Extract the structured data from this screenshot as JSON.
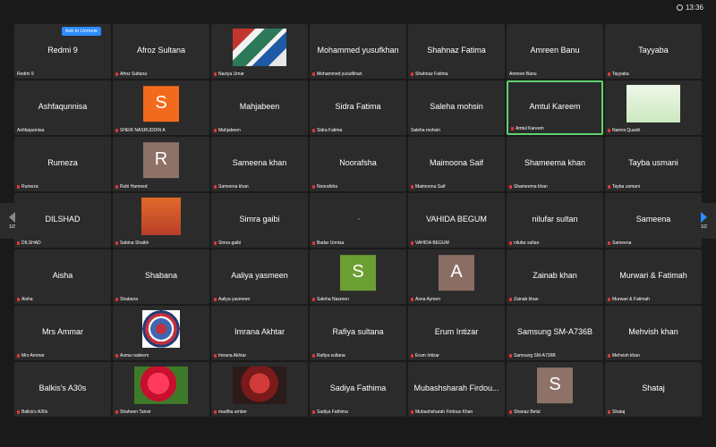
{
  "clock": "13:36",
  "unmute_label": "Ask to Unmute",
  "more_label": "···",
  "pager_left": "1/2",
  "pager_right": "1/2",
  "colors": {
    "orange": "#f26a1b",
    "taupe": "#8e7268",
    "green": "#6c9f32",
    "brown": "#8a6e64",
    "active": "#5fd36f",
    "accent": "#2d8cff"
  },
  "tiles": [
    {
      "name": "Redmi 9",
      "label": "Redmi 9"
    },
    {
      "name": "Afroz Sultana",
      "label": "Afroz Sultana"
    },
    {
      "name": "",
      "label": "Naziya Umar",
      "media": "mosaic"
    },
    {
      "name": "Mohammed yusufkhan",
      "label": "Mohammed yusufkhan"
    },
    {
      "name": "Shahnaz Fatima",
      "label": "Shahnaz Fatima"
    },
    {
      "name": "Amreen Banu",
      "label": "Amreen Banu"
    },
    {
      "name": "Tayyaba",
      "label": "Tayyaba"
    },
    {
      "name": "Ashfaqunnisa",
      "label": "Ashfaqunnisa"
    },
    {
      "name": "",
      "label": "SHEIK NASRUDDIN A",
      "avatar": "S",
      "color": "orange"
    },
    {
      "name": "Mahjabeen",
      "label": "Mahjabeen"
    },
    {
      "name": "Sidra Fatima",
      "label": "Sidra Fatima"
    },
    {
      "name": "Saleha mohsin",
      "label": "Saleha mohsin"
    },
    {
      "name": "Amtul Kareem",
      "label": "Amtul Kareem",
      "active": true
    },
    {
      "name": "",
      "label": "Namra Quadri",
      "media": "quote"
    },
    {
      "name": "Rumeza",
      "label": "Rumeza"
    },
    {
      "name": "",
      "label": "Ruhi Hameed",
      "avatar": "R",
      "color": "taupe"
    },
    {
      "name": "Sameena khan",
      "label": "Sameena khan"
    },
    {
      "name": "Noorafsha",
      "label": "Noorafsha"
    },
    {
      "name": "Maimoona Saif",
      "label": "Maimoona Saif"
    },
    {
      "name": "Shameema khan",
      "label": "Shameema khan"
    },
    {
      "name": "Tayba usmani",
      "label": "Tayba usmani"
    },
    {
      "name": "DILSHAD",
      "label": "DILSHAD"
    },
    {
      "name": "",
      "label": "Sabina Shaikh",
      "media": "tower"
    },
    {
      "name": "Simra gaibi",
      "label": "Simra gaibi"
    },
    {
      "name": "",
      "label": "Badar Unnisa",
      "media": "dot"
    },
    {
      "name": "VAHIDA BEGUM",
      "label": "VAHIDA BEGUM"
    },
    {
      "name": "nilufar sultan",
      "label": "nilufar sultan"
    },
    {
      "name": "Sameena",
      "label": "Sameena"
    },
    {
      "name": "Aisha",
      "label": "Aisha"
    },
    {
      "name": "Shabana",
      "label": "Shabana"
    },
    {
      "name": "Aaliya yasmeen",
      "label": "Aaliya yasmeen"
    },
    {
      "name": "",
      "label": "Saleha Nasreen",
      "avatar": "S",
      "color": "green"
    },
    {
      "name": "",
      "label": "Asna Aymen",
      "avatar": "A",
      "color": "brown"
    },
    {
      "name": "Zainab khan",
      "label": "Zainab khan"
    },
    {
      "name": "Murwari & Fatimah",
      "label": "Murwari & Fatimah"
    },
    {
      "name": "Mrs Ammar",
      "label": "Mrs Ammar"
    },
    {
      "name": "",
      "label": "Asma nadeem",
      "media": "mandala"
    },
    {
      "name": "Imrana Akhtar",
      "label": "Imrana Akhtar"
    },
    {
      "name": "Rafiya sultana",
      "label": "Rafiya sultana"
    },
    {
      "name": "Erum Intizar",
      "label": "Erum Intizar"
    },
    {
      "name": "Samsung SM-A736B",
      "label": "Samsung SM-A736B"
    },
    {
      "name": "Mehvish khan",
      "label": "Mehvish khan"
    },
    {
      "name": "Balkis's A30s",
      "label": "Balkis's A30s"
    },
    {
      "name": "",
      "label": "Shaheen Tanvir",
      "media": "rose"
    },
    {
      "name": "",
      "label": "madiha amber",
      "media": "flowers"
    },
    {
      "name": "Sadiya Fathima",
      "label": "Sadiya Fathima"
    },
    {
      "name": "Mubashsharah Firdou...",
      "label": "Mubashsharah Firdous Khan"
    },
    {
      "name": "",
      "label": "Shanaz Belul",
      "avatar": "S",
      "color": "taupe"
    },
    {
      "name": "Shataj",
      "label": "Shataj"
    }
  ]
}
